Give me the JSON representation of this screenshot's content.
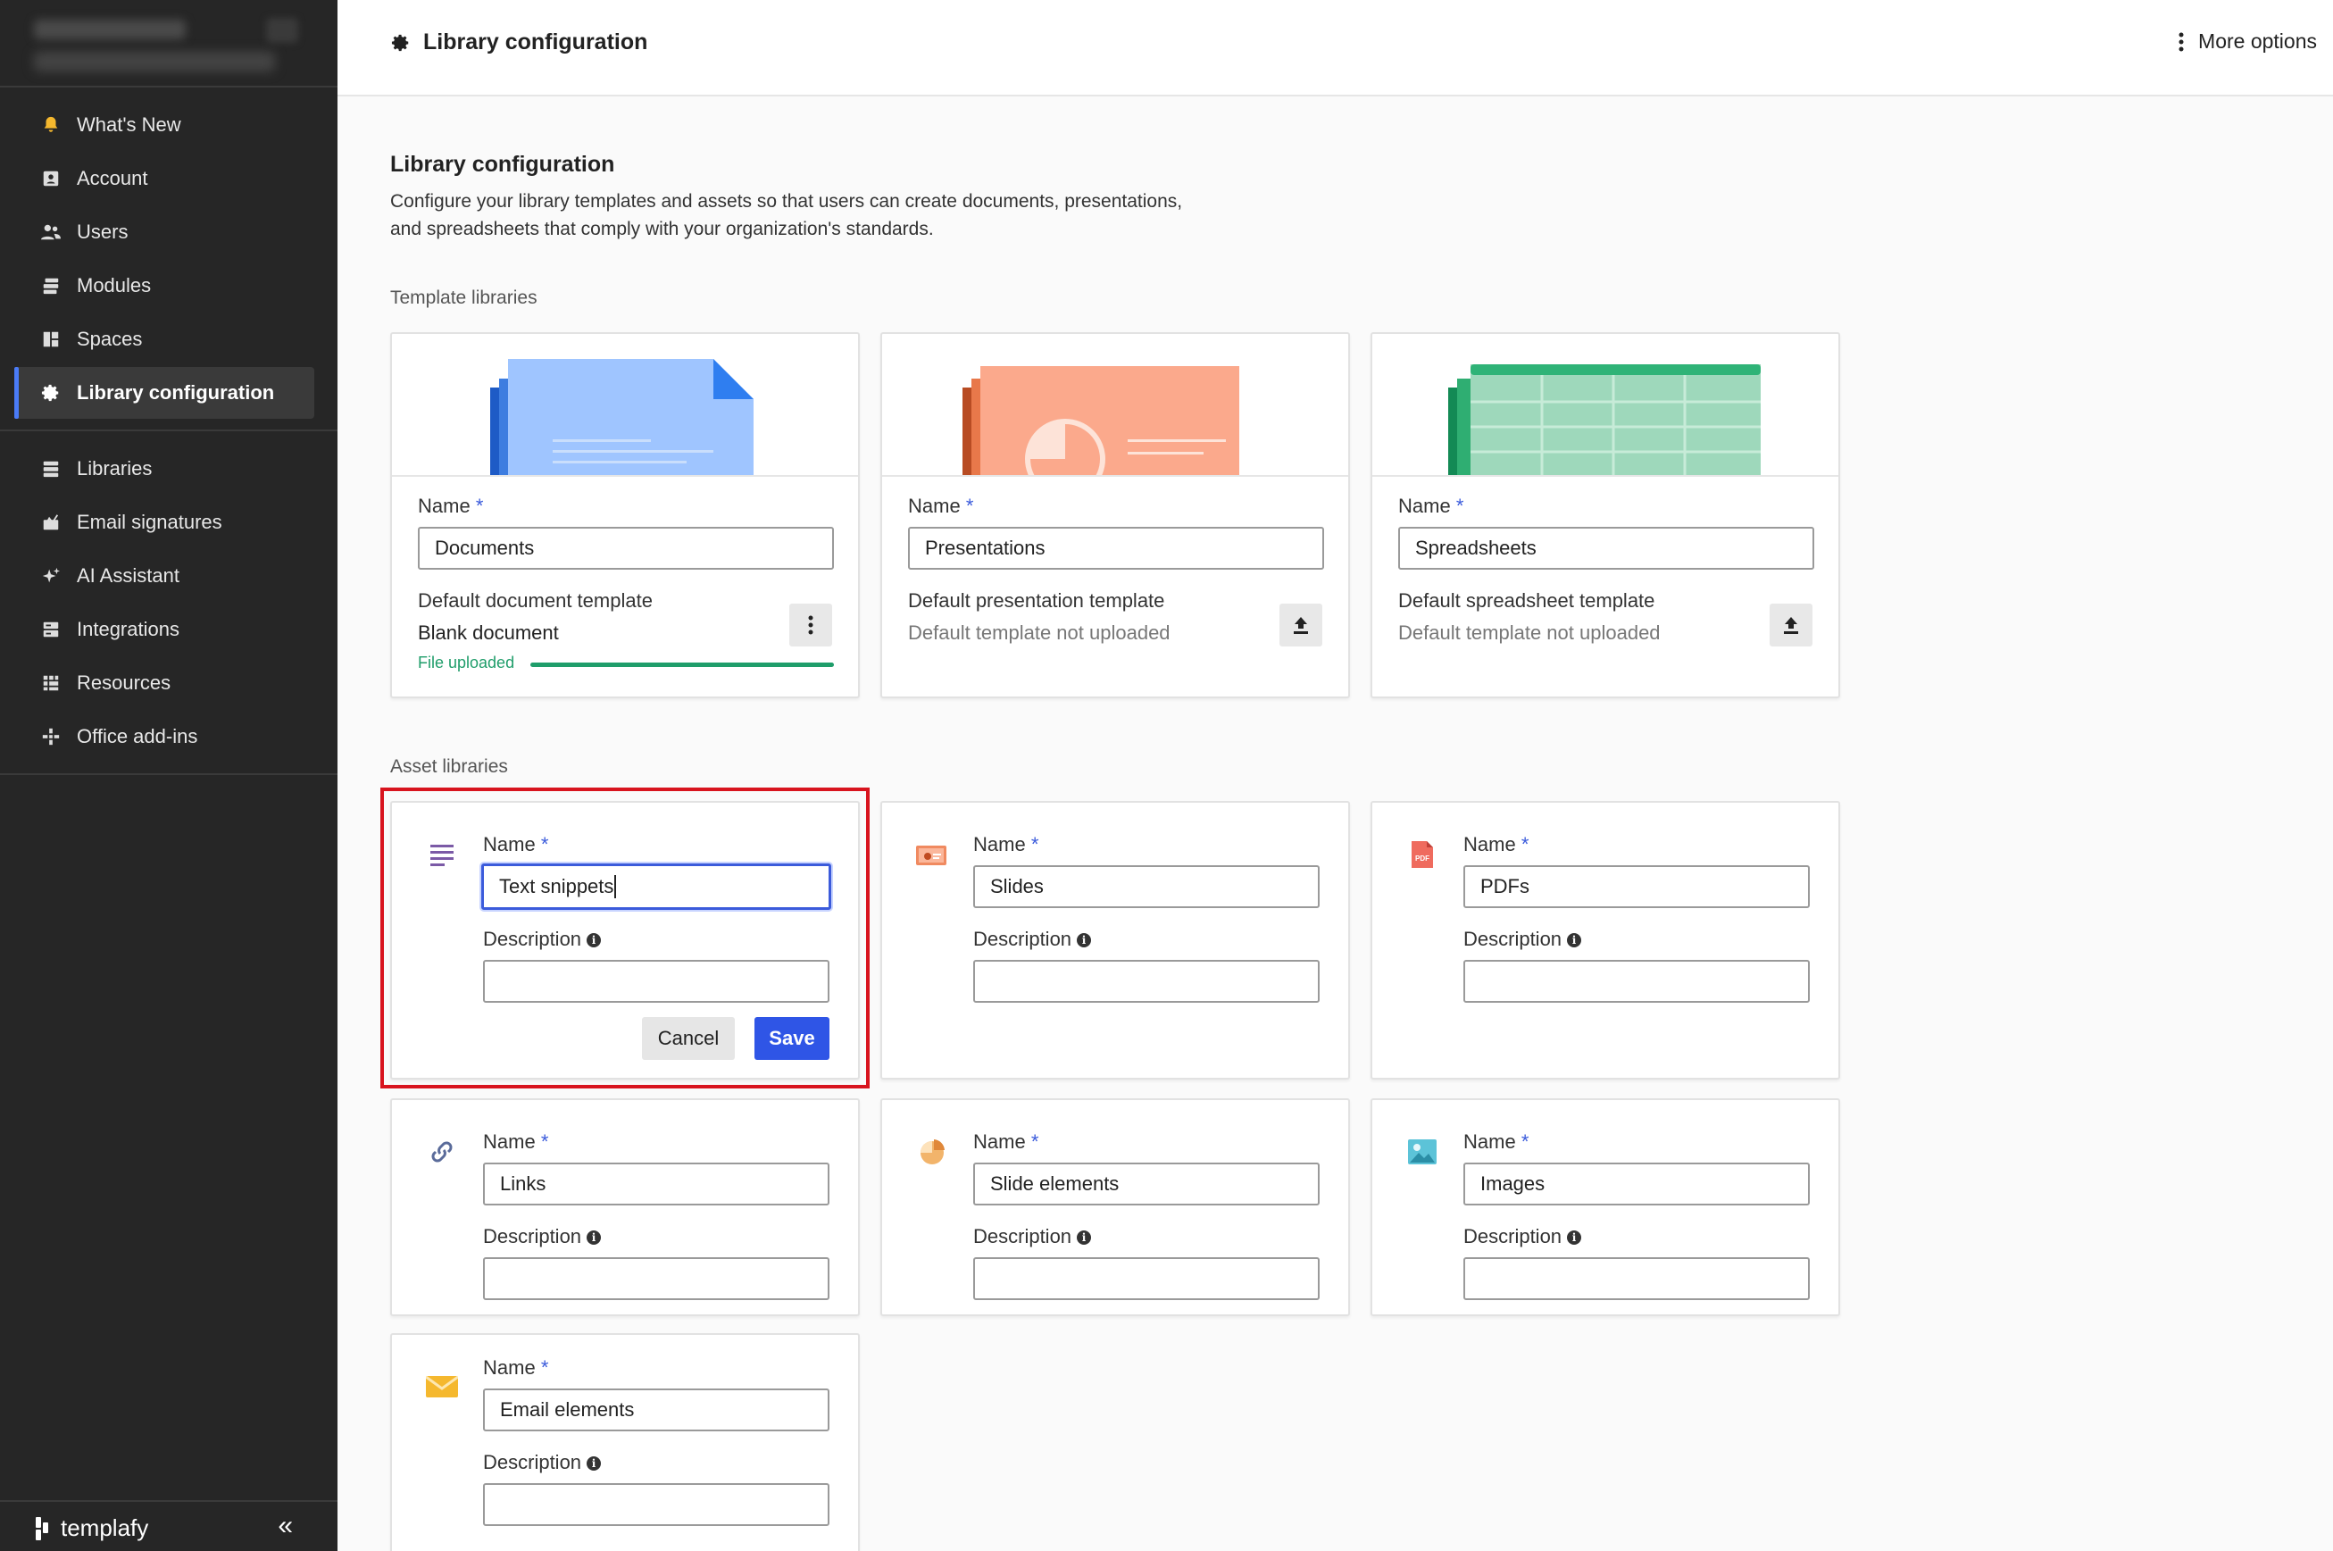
{
  "sidebar": {
    "nav_primary": [
      {
        "label": "What's New",
        "icon": "bell-icon"
      },
      {
        "label": "Account",
        "icon": "account-icon"
      },
      {
        "label": "Users",
        "icon": "users-icon"
      },
      {
        "label": "Modules",
        "icon": "modules-icon"
      },
      {
        "label": "Spaces",
        "icon": "spaces-icon"
      },
      {
        "label": "Library configuration",
        "icon": "gear-icon",
        "active": true
      }
    ],
    "nav_secondary": [
      {
        "label": "Libraries",
        "icon": "libraries-icon"
      },
      {
        "label": "Email signatures",
        "icon": "email-signature-icon"
      },
      {
        "label": "AI Assistant",
        "icon": "sparkle-icon"
      },
      {
        "label": "Integrations",
        "icon": "integrations-icon"
      },
      {
        "label": "Resources",
        "icon": "resources-icon"
      },
      {
        "label": "Office add-ins",
        "icon": "add-ins-icon"
      }
    ],
    "brand": "templafy",
    "collapse_glyph": "«"
  },
  "header": {
    "title": "Library configuration",
    "more_label": "More options"
  },
  "main": {
    "title": "Library configuration",
    "description": "Configure your library templates and assets so that users can create documents, presentations, and spreadsheets that comply with your organization's standards.",
    "template_section": "Template libraries",
    "asset_section": "Asset libraries",
    "name_label": "Name",
    "required_mark": "*",
    "description_label": "Description",
    "info_glyph": "i",
    "templates": [
      {
        "name": "Documents",
        "default_label": "Default document template",
        "default_value": "Blank document",
        "status": "File uploaded",
        "progress_percent": 100,
        "action": "kebab-menu"
      },
      {
        "name": "Presentations",
        "default_label": "Default presentation template",
        "default_value": "Default template not uploaded",
        "action": "upload"
      },
      {
        "name": "Spreadsheets",
        "default_label": "Default spreadsheet template",
        "default_value": "Default template not uploaded",
        "action": "upload"
      }
    ],
    "assets": [
      {
        "name": "Text snippets",
        "description": "",
        "icon": "text-lines-icon",
        "editing": true
      },
      {
        "name": "Slides",
        "description": "",
        "icon": "slides-icon"
      },
      {
        "name": "PDFs",
        "description": "",
        "icon": "pdf-icon"
      },
      {
        "name": "Links",
        "description": "",
        "icon": "link-icon"
      },
      {
        "name": "Slide elements",
        "description": "",
        "icon": "pie-icon"
      },
      {
        "name": "Images",
        "description": "",
        "icon": "image-icon"
      },
      {
        "name": "Email elements",
        "description": "",
        "icon": "envelope-icon"
      }
    ],
    "cancel_label": "Cancel",
    "save_label": "Save"
  },
  "colors": {
    "sidebar_bg": "#262626",
    "accent_blue": "#2f55e6",
    "success_green": "#1f9d6a",
    "highlight_red": "#d8141e"
  }
}
